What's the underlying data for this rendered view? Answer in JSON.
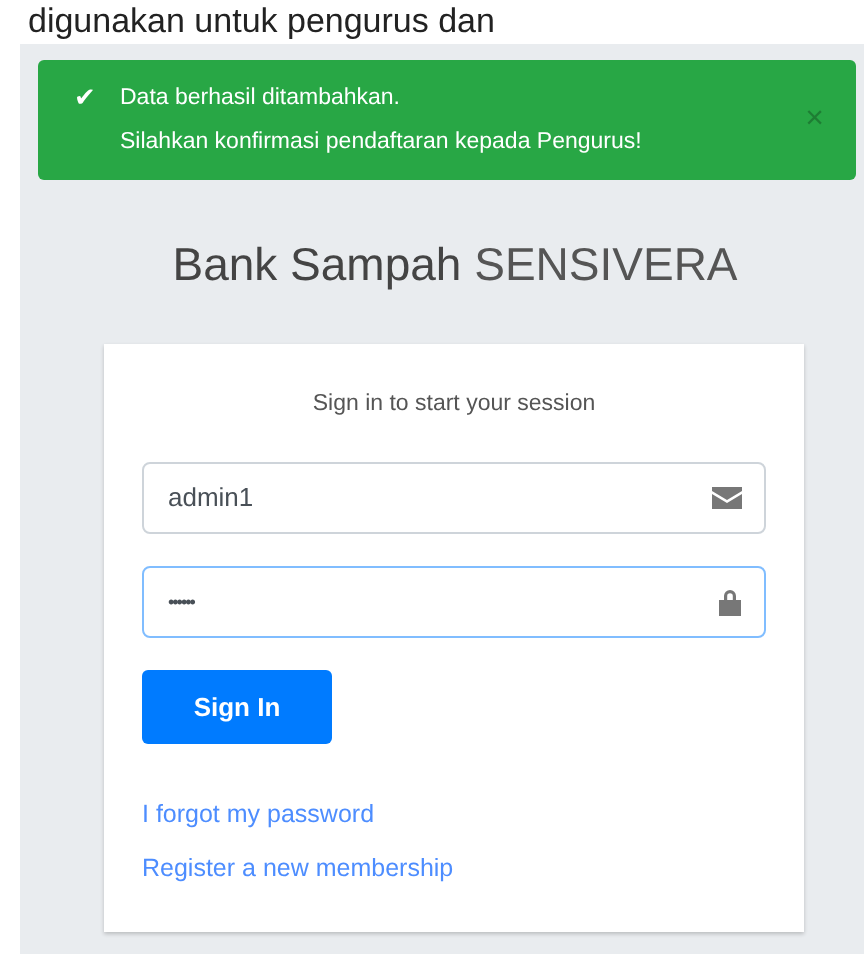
{
  "header_fragment": "digunakan untuk pengurus dan",
  "alert": {
    "icon": "✔",
    "lines": [
      "Data berhasil ditambahkan.",
      "Silahkan konfirmasi pendaftaran kepada Pengurus!"
    ],
    "close": "×"
  },
  "brand": {
    "bold": "Bank Sampah",
    "light": "SENSIVERA"
  },
  "login": {
    "message": "Sign in to start your session",
    "fields": [
      {
        "kind": "email",
        "value": "admin1",
        "focused": false
      },
      {
        "kind": "password",
        "value": "••••••",
        "focused": true
      }
    ],
    "button": "Sign In",
    "links": [
      "I forgot my password",
      "Register a new membership"
    ]
  }
}
